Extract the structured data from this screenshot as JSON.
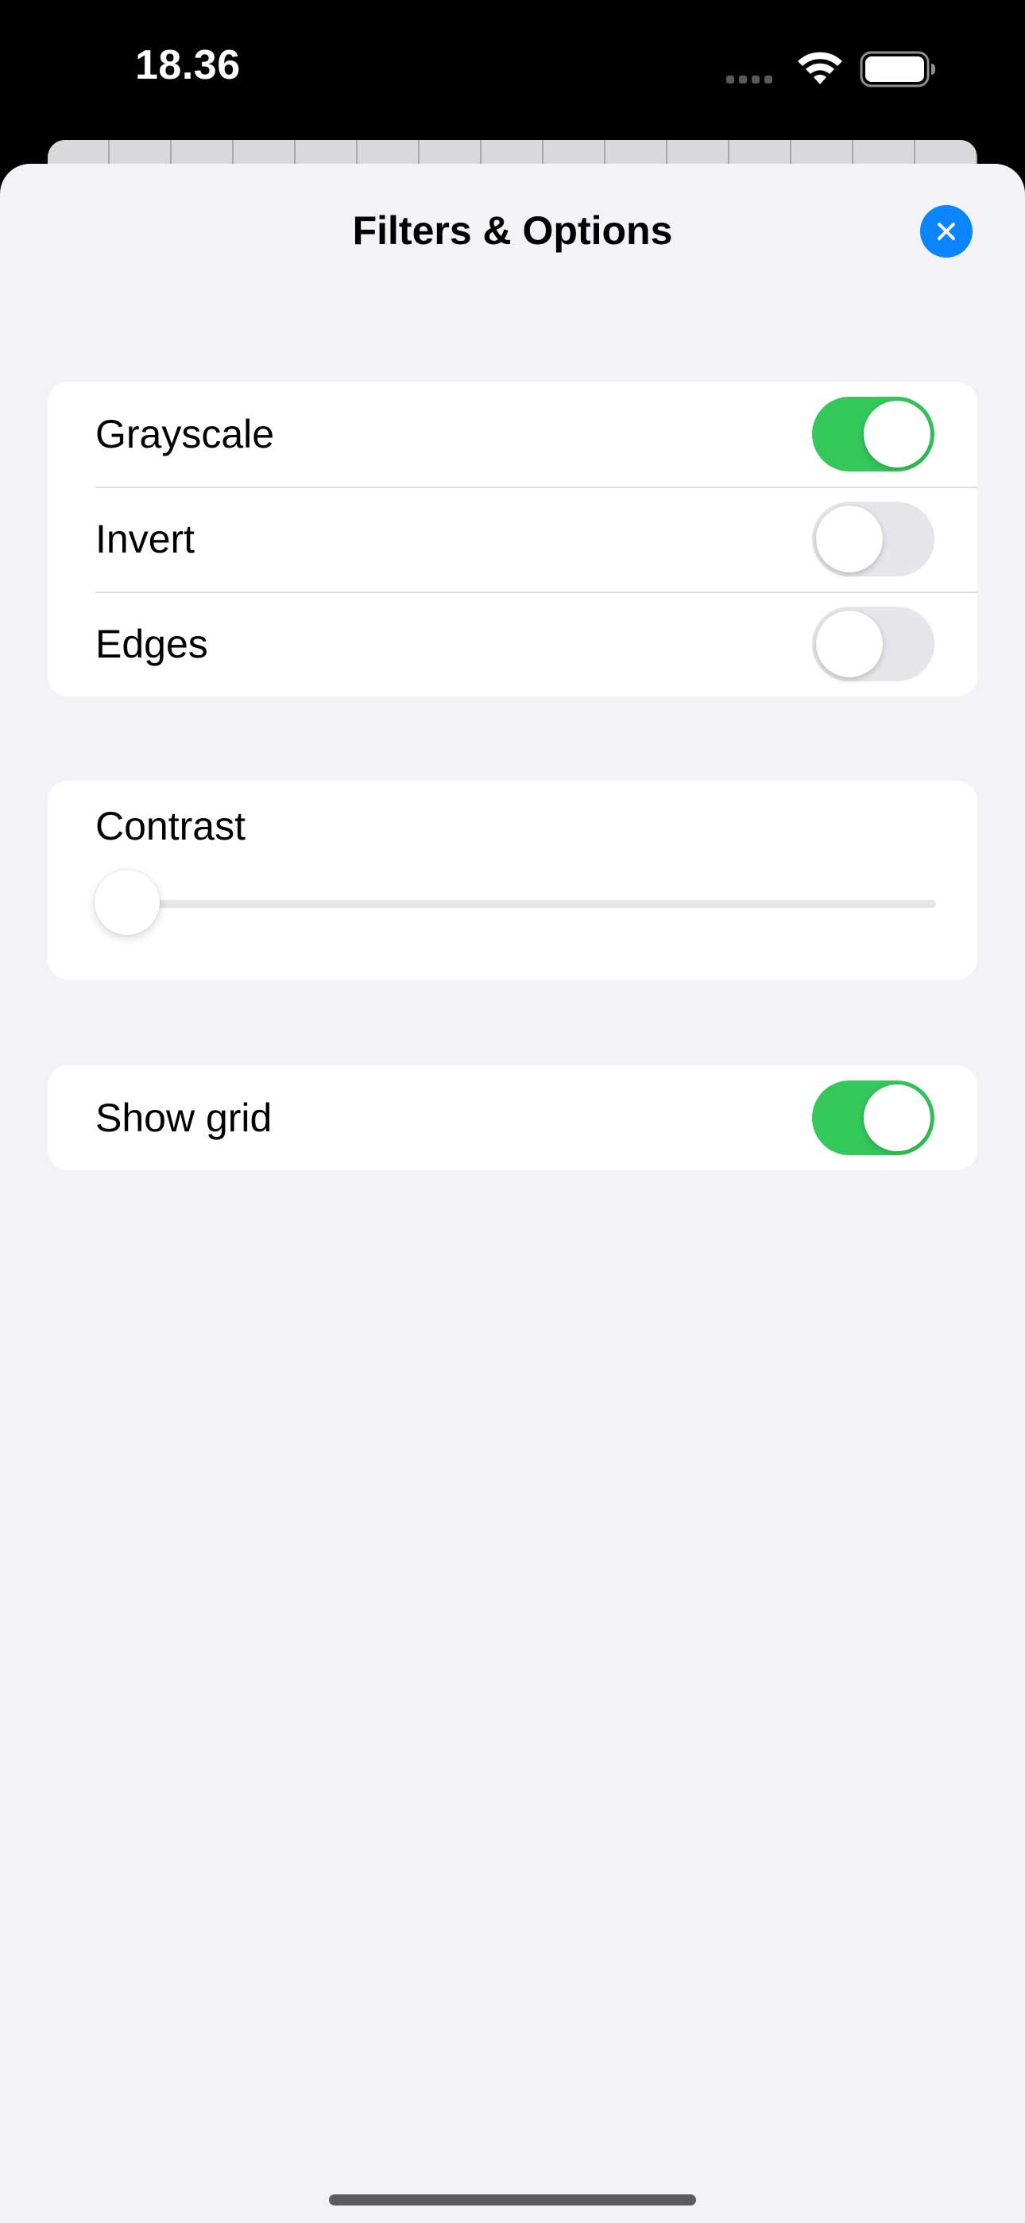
{
  "status_bar": {
    "time": "18.36",
    "icons": [
      "cellular-icon",
      "wifi-icon",
      "battery-icon"
    ]
  },
  "sheet": {
    "title": "Filters & Options",
    "close_icon": "close-icon",
    "accent_color": "#0a84ff"
  },
  "filters": [
    {
      "label": "Grayscale",
      "on": true
    },
    {
      "label": "Invert",
      "on": false
    },
    {
      "label": "Edges",
      "on": false
    }
  ],
  "contrast": {
    "label": "Contrast",
    "value": 0.0
  },
  "grid": {
    "label": "Show grid",
    "on": true
  },
  "colors": {
    "toggle_on": "#34c759",
    "toggle_off": "#e5e5ea",
    "background": "#f2f2f7"
  }
}
